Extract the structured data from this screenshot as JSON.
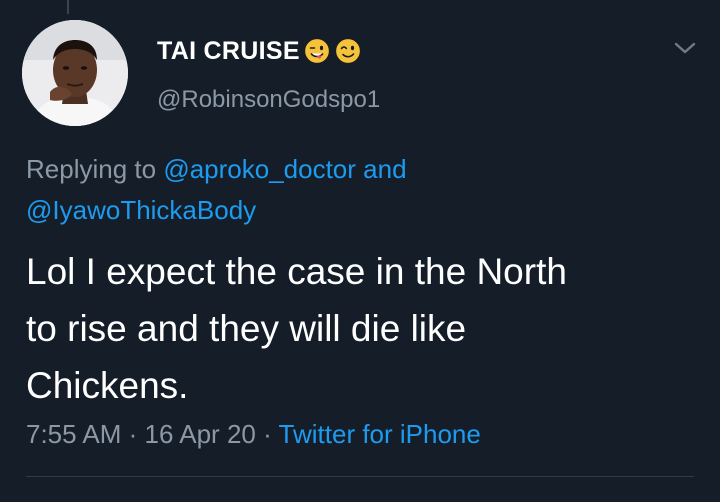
{
  "tweet": {
    "display_name": "TAI CRUISE",
    "handle": "@RobinsonGodspo1",
    "name_emojis": [
      "winking-face-with-tongue-icon",
      "winking-face-icon"
    ],
    "reply": {
      "prefix": "Replying to",
      "mention_1": "@aproko_doctor",
      "conjunction": "and",
      "mention_2": "@IyawoThickaBody"
    },
    "text_lines": [
      "Lol I expect the case in the North",
      "to rise and they will die like",
      "Chickens."
    ],
    "time": "7:55 AM",
    "date": "16 Apr 20",
    "source": "Twitter for iPhone",
    "separator": "·"
  },
  "colors": {
    "background": "#151e28",
    "text_primary": "#ffffff",
    "text_secondary": "#8b98a5",
    "link": "#1d9bf0"
  }
}
